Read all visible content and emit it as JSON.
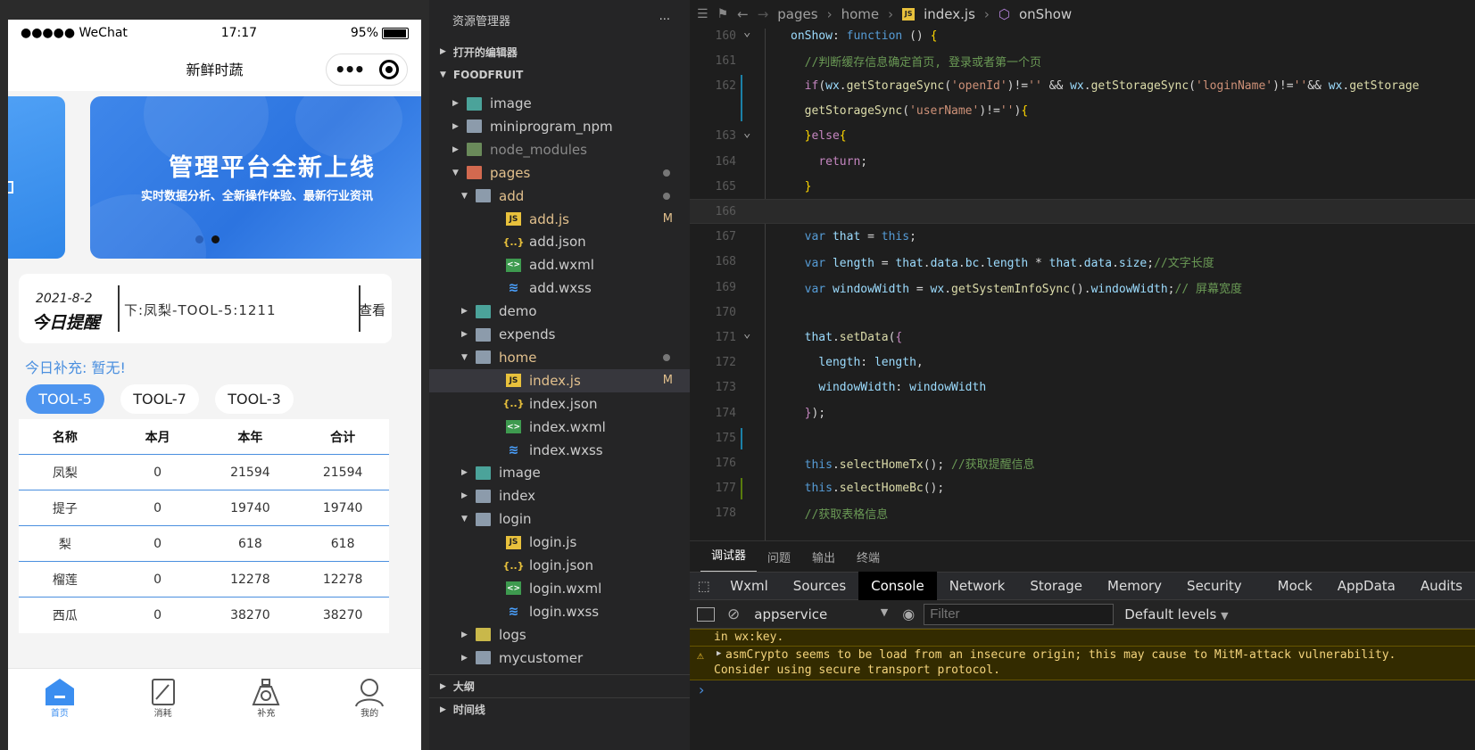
{
  "phone": {
    "status": {
      "carrier": "●●●●● WeChat",
      "time": "17:17",
      "battery": "95%"
    },
    "nav_title": "新鲜时蔬",
    "banner": {
      "title": "管理平台全新上线",
      "subtitle": "实时数据分析、全新操作体验、最新行业资讯"
    },
    "reminder": {
      "date": "2021-8-2",
      "label": "今日提醒",
      "message": "下:凤梨-TOOL-5:1211",
      "view": "查看"
    },
    "supplement": "今日补充: 暂无!",
    "chips": [
      "TOOL-5",
      "TOOL-7",
      "TOOL-3"
    ],
    "table": {
      "headers": [
        "名称",
        "本月",
        "本年",
        "合计"
      ],
      "rows": [
        [
          "凤梨",
          "0",
          "21594",
          "21594"
        ],
        [
          "提子",
          "0",
          "19740",
          "19740"
        ],
        [
          "梨",
          "0",
          "618",
          "618"
        ],
        [
          "榴莲",
          "0",
          "12278",
          "12278"
        ],
        [
          "西瓜",
          "0",
          "38270",
          "38270"
        ]
      ]
    },
    "tabbar": [
      "首页",
      "消耗",
      "补充",
      "我的"
    ]
  },
  "explorer": {
    "title": "资源管理器",
    "more": "···",
    "open_editors": "打开的编辑器",
    "project": "FOODFRUIT",
    "tree": [
      {
        "name": "image",
        "arrow": "▶",
        "icon": "folder-img",
        "depth": 1
      },
      {
        "name": "miniprogram_npm",
        "arrow": "▶",
        "icon": "folder",
        "depth": 1
      },
      {
        "name": "node_modules",
        "arrow": "▶",
        "icon": "folder-node",
        "depth": 1,
        "dim": true
      },
      {
        "name": "pages",
        "arrow": "▼",
        "icon": "folder-pages",
        "depth": 1,
        "dot": true,
        "orange": true
      },
      {
        "name": "add",
        "arrow": "▼",
        "icon": "folder-open",
        "depth": 2,
        "dot": true,
        "orange": true
      },
      {
        "name": "add.js",
        "icon": "js",
        "depth": 3,
        "badge": "M",
        "orange": true
      },
      {
        "name": "add.json",
        "icon": "json",
        "depth": 3
      },
      {
        "name": "add.wxml",
        "icon": "wxml",
        "depth": 3
      },
      {
        "name": "add.wxss",
        "icon": "wxss",
        "depth": 3
      },
      {
        "name": "demo",
        "arrow": "▶",
        "icon": "folder-img",
        "depth": 2
      },
      {
        "name": "expends",
        "arrow": "▶",
        "icon": "folder",
        "depth": 2
      },
      {
        "name": "home",
        "arrow": "▼",
        "icon": "folder-open",
        "depth": 2,
        "dot": true,
        "orange": true
      },
      {
        "name": "index.js",
        "icon": "js",
        "depth": 3,
        "badge": "M",
        "orange": true,
        "selected": true
      },
      {
        "name": "index.json",
        "icon": "json",
        "depth": 3
      },
      {
        "name": "index.wxml",
        "icon": "wxml",
        "depth": 3
      },
      {
        "name": "index.wxss",
        "icon": "wxss",
        "depth": 3
      },
      {
        "name": "image",
        "arrow": "▶",
        "icon": "folder-img",
        "depth": 2
      },
      {
        "name": "index",
        "arrow": "▶",
        "icon": "folder",
        "depth": 2
      },
      {
        "name": "login",
        "arrow": "▼",
        "icon": "folder-open",
        "depth": 2
      },
      {
        "name": "login.js",
        "icon": "js",
        "depth": 3
      },
      {
        "name": "login.json",
        "icon": "json",
        "depth": 3
      },
      {
        "name": "login.wxml",
        "icon": "wxml",
        "depth": 3
      },
      {
        "name": "login.wxss",
        "icon": "wxss",
        "depth": 3
      },
      {
        "name": "logs",
        "arrow": "▶",
        "icon": "folder-logs",
        "depth": 2
      },
      {
        "name": "mycustomer",
        "arrow": "▶",
        "icon": "folder",
        "depth": 2
      }
    ],
    "outline": "大纲",
    "timeline": "时间线"
  },
  "editor": {
    "breadcrumb": [
      "pages",
      "home",
      "index.js",
      "onShow"
    ],
    "lines": [
      {
        "n": "160",
        "fold": true,
        "html": "<span class='var'>onShow</span><span class='pun'>: </span><span class='kw'>function</span><span class='pun'> () </span><span class='yel'>{</span>"
      },
      {
        "n": "161",
        "html": "  <span class='cm'>//判断缓存信息确定首页, 登录或者第一个页</span>"
      },
      {
        "n": "162",
        "html": "  <span class='ctl'>if</span><span class='pun'>(</span><span class='var'>wx</span>.<span class='fn'>getStorageSync</span>(<span class='str'>'openId'</span>)!=<span class='str'>''</span> && <span class='var'>wx</span>.<span class='fn'>getStorageSync</span>(<span class='str'>'loginName'</span>)!=<span class='str'>''</span>&& <span class='var'>wx</span>.<span class='fn'>getStorage</span>"
      },
      {
        "n": "",
        "html": "  <span class='fn'>getStorageSync</span>(<span class='str'>'userName'</span>)!=<span class='str'>''</span>)<span class='yel'>{</span>"
      },
      {
        "n": "163",
        "fold": true,
        "html": "  <span class='yel'>}</span><span class='ctl'>else</span><span class='yel'>{</span>"
      },
      {
        "n": "164",
        "html": "    <span class='ctl'>return</span>;"
      },
      {
        "n": "165",
        "html": "  <span class='yel'>}</span>"
      },
      {
        "n": "166",
        "cur": true,
        "html": ""
      },
      {
        "n": "167",
        "html": "  <span class='kw'>var</span> <span class='var'>that</span> = <span class='kw'>this</span>;"
      },
      {
        "n": "168",
        "html": "  <span class='kw'>var</span> <span class='var'>length</span> = <span class='var'>that</span>.<span class='var'>data</span>.<span class='var'>bc</span>.<span class='var'>length</span> * <span class='var'>that</span>.<span class='var'>data</span>.<span class='var'>size</span>;<span class='cm'>//文字长度</span>"
      },
      {
        "n": "169",
        "html": "  <span class='kw'>var</span> <span class='var'>windowWidth</span> = <span class='var'>wx</span>.<span class='fn'>getSystemInfoSync</span>().<span class='var'>windowWidth</span>;<span class='cm'>// 屏幕宽度</span>"
      },
      {
        "n": "170",
        "html": ""
      },
      {
        "n": "171",
        "fold": true,
        "html": "  <span class='var'>that</span>.<span class='fn'>setData</span>(<span class='ctl'>{</span>"
      },
      {
        "n": "172",
        "html": "    <span class='var'>length</span>: <span class='var'>length</span>,"
      },
      {
        "n": "173",
        "html": "    <span class='var'>windowWidth</span>: <span class='var'>windowWidth</span>"
      },
      {
        "n": "174",
        "html": "  <span class='ctl'>}</span>);"
      },
      {
        "n": "175",
        "html": ""
      },
      {
        "n": "176",
        "html": "  <span class='kw'>this</span>.<span class='fn'>selectHomeTx</span>(); <span class='cm'>//获取提醒信息</span>"
      },
      {
        "n": "177",
        "html": "  <span class='kw'>this</span>.<span class='fn'>selectHomeBc</span>();"
      },
      {
        "n": "178",
        "html": "  <span class='cm'>//获取表格信息</span>"
      }
    ]
  },
  "panel": {
    "tabs": [
      "调试器",
      "问题",
      "输出",
      "终端"
    ],
    "devtools_tabs": [
      "Wxml",
      "Sources",
      "Console",
      "Network",
      "Storage",
      "Memory",
      "Security",
      "Mock",
      "AppData",
      "Audits"
    ],
    "context": "appservice",
    "filter_placeholder": "Filter",
    "levels": "Default levels",
    "log_tail": "in wx:key.",
    "warning_line1": "asmCrypto seems to be load from an insecure origin; this may cause to MitM-attack vulnerability.",
    "warning_line2": "Consider using secure transport protocol.",
    "prompt": "›"
  }
}
